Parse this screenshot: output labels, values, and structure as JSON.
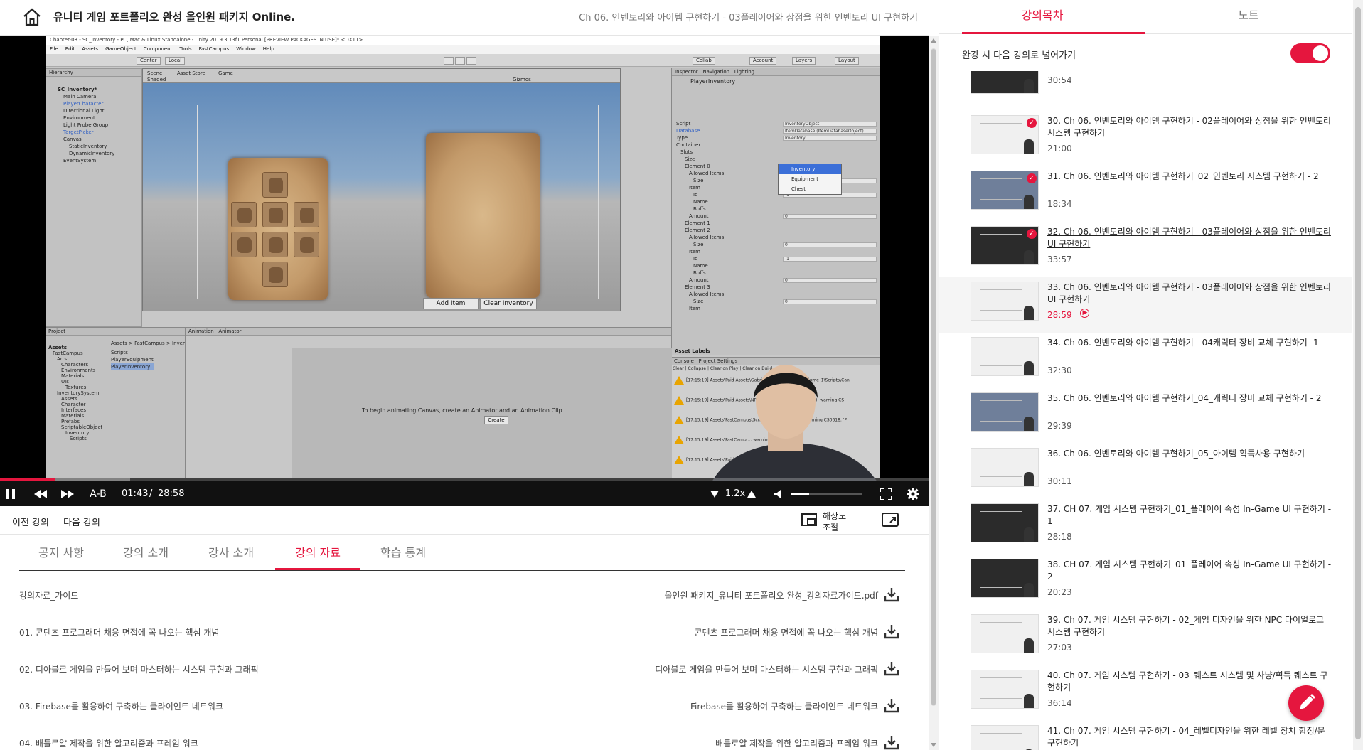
{
  "header": {
    "course_title": "유니티 게임 포트폴리오 완성 올인원 패키지 Online.",
    "lecture_title": "Ch 06. 인벤토리와 아이템 구현하기 - 03플레이어와 상점을 위한 인벤토리 UI 구현하기"
  },
  "unity": {
    "window_title": "Chapter-08 - SC_Inventory - PC, Mac & Linux Standalone - Unity 2019.3.13f1 Personal [PREVIEW PACKAGES IN USE]* <DX11>",
    "menu": [
      "File",
      "Edit",
      "Assets",
      "GameObject",
      "Component",
      "Tools",
      "FastCampus",
      "Window",
      "Help"
    ],
    "toolbar": {
      "center": "Center",
      "local": "Local",
      "collab": "Collab",
      "account": "Account",
      "layers": "Layers",
      "layout": "Layout"
    },
    "hierarchy_tab": "Hierarchy",
    "hierarchy": [
      "SC_Inventory*",
      "Main Camera",
      "PlayerCharacter",
      "Directional Light",
      "Environment",
      "Light Probe Group",
      "TargetPicker",
      "Canvas",
      "StaticInventory",
      "DynamicInventory",
      "EventSystem"
    ],
    "scene_tabs": [
      "Scene",
      "Asset Store",
      "Game"
    ],
    "scene_mode": "Shaded",
    "gizmos": "Gizmos",
    "buttons": {
      "add_item": "Add Item",
      "clear_inventory": "Clear Inventory"
    },
    "inspector_tabs": [
      "Inspector",
      "Navigation",
      "Lighting"
    ],
    "inspector_object": "PlayerInventory",
    "inspector_rows": [
      {
        "label": "Script",
        "value": "InventoryObject"
      },
      {
        "label": "Database",
        "value": "ItemDatabase (ItemDatabaseObject)"
      },
      {
        "label": "Type",
        "value": "Inventory"
      },
      {
        "label": "Container",
        "value": ""
      },
      {
        "label": "Slots",
        "value": ""
      },
      {
        "label": "Size",
        "value": ""
      },
      {
        "label": "Element 0",
        "value": ""
      },
      {
        "label": "Allowed Items",
        "value": ""
      },
      {
        "label": "Size",
        "value": "0"
      },
      {
        "label": "Item",
        "value": ""
      },
      {
        "label": "Id",
        "value": "-1"
      },
      {
        "label": "Name",
        "value": ""
      },
      {
        "label": "Buffs",
        "value": ""
      },
      {
        "label": "Amount",
        "value": "0"
      },
      {
        "label": "Element 1",
        "value": ""
      },
      {
        "label": "Element 2",
        "value": ""
      },
      {
        "label": "Allowed Items",
        "value": ""
      },
      {
        "label": "Size",
        "value": "0"
      },
      {
        "label": "Item",
        "value": ""
      },
      {
        "label": "Id",
        "value": "-1"
      },
      {
        "label": "Name",
        "value": ""
      },
      {
        "label": "Buffs",
        "value": ""
      },
      {
        "label": "Amount",
        "value": "0"
      },
      {
        "label": "Element 3",
        "value": ""
      },
      {
        "label": "Allowed Items",
        "value": ""
      },
      {
        "label": "Size",
        "value": "0"
      },
      {
        "label": "Item",
        "value": ""
      }
    ],
    "type_options": [
      "Inventory",
      "Equipment",
      "Chest"
    ],
    "asset_labels": "Asset Labels",
    "console_tabs": [
      "Console",
      "Project Settings"
    ],
    "console_buttons": [
      "Clear",
      "Collapse",
      "Clear on Play",
      "Clear on Build"
    ],
    "console_rows": [
      "[17:15:19] Assets\\Paid Assets\\GabrielAguiar\\...\\ectiles_Volume_1\\Scripts\\Can",
      "[17:15:19] Assets\\Paid Assets\\NPCHealth...\\arEditor.cs(90,13): warning CS",
      "[17:15:19] Assets\\FastCampus\\Scripts\\Edit...\\cs(26,25): warning CS0618: 'P",
      "[17:15:19] Assets\\FastCamp...: warning CS0618: 'Pr",
      "[17:15:19] Assets\\Paid Asset...: warning CS0618: 'P"
    ],
    "project_tab": "Project",
    "animation_tabs": [
      "Animation",
      "Animator"
    ],
    "project_tree": [
      "Assets",
      "FastCampus",
      "Arts",
      "Characters",
      "Environments",
      "Materials",
      "UIs",
      "Textures",
      "InventorySystem",
      "Assets",
      "Character",
      "Interfaces",
      "Materials",
      "Prefabs",
      "ScriptableObject",
      "Inventory",
      "Scripts"
    ],
    "project_path": "Assets > FastCampus > InventoryS",
    "project_files": [
      "Scripts",
      "PlayerEquipment",
      "PlayerInventory"
    ],
    "animation_hint": "To begin animating Canvas, create an Animator and an Animation Clip.",
    "animation_create": "Create"
  },
  "player": {
    "current_time": "01:43",
    "separator": "/",
    "total_time": "28:58",
    "ab_label": "A-B",
    "speed": "1.2x",
    "progress": 0.059,
    "volume": 0.25
  },
  "nav": {
    "prev": "이전 강의",
    "next": "다음 강의",
    "resolution": "해상도\n조절"
  },
  "tabs": [
    "공지 사항",
    "강의 소개",
    "강사 소개",
    "강의 자료",
    "학습 통계"
  ],
  "materials": [
    {
      "title": "강의자료_가이드",
      "file": "올인원 패키지_유니티 포트폴리오 완성_강의자료가이드.pdf"
    },
    {
      "title": "01. 콘텐츠 프로그래머 채용 면접에 꼭 나오는 핵심 개념",
      "file": "콘텐츠 프로그래머 채용 면접에 꼭 나오는 핵심 개념"
    },
    {
      "title": "02. 디아블로 게임을 만들어 보며 마스터하는 시스템 구현과 그래픽",
      "file": "디아블로 게임을 만들어 보며 마스터하는 시스템 구현과 그래픽"
    },
    {
      "title": "03. Firebase를 활용하여 구축하는 클라이언트 네트워크",
      "file": "Firebase를 활용하여 구축하는 클라이언트 네트워크"
    },
    {
      "title": "04. 배틀로얄 제작을 위한 알고리즘과 프레임 워크",
      "file": "배틀로얄 제작을 위한 알고리즘과 프레임 워크"
    }
  ],
  "sidebar": {
    "tabs": [
      "강의목차",
      "노트"
    ],
    "autoplay_label": "완강 시 다음 강의로 넘어가기",
    "autoplay_on": true,
    "lessons": [
      {
        "title": "",
        "duration": "30:54",
        "done": false,
        "thumb": "dark"
      },
      {
        "title": "30. Ch 06. 인벤토리와 아이템 구현하기 - 02플레이어와 상점을 위한 인벤토리 시스템 구현하기",
        "duration": "21:00",
        "done": true,
        "thumb": "light"
      },
      {
        "title": "31. Ch 06. 인벤토리와 아이템 구현하기_02_인벤토리 시스템 구현하기 - 2",
        "duration": "18:34",
        "done": true,
        "thumb": "video"
      },
      {
        "title": "32. Ch 06. 인벤토리와 아이템 구현하기 - 03플레이어와 상점을 위한 인벤토리 UI 구현하기",
        "duration": "33:57",
        "done": true,
        "thumb": "dark"
      },
      {
        "title": "33. Ch 06. 인벤토리와 아이템 구현하기 - 03플레이어와 상점을 위한 인벤토리 UI 구현하기",
        "duration": "28:59",
        "done": false,
        "thumb": "light"
      },
      {
        "title": "34. Ch 06. 인벤토리와 아이템 구현하기 - 04캐릭터 장비 교체 구현하기 -1",
        "duration": "32:30",
        "done": false,
        "thumb": "light"
      },
      {
        "title": "35. Ch 06. 인벤토리와 아이템 구현하기_04_캐릭터 장비 교체 구현하기 - 2",
        "duration": "29:39",
        "done": false,
        "thumb": "video"
      },
      {
        "title": "36. Ch 06. 인벤토리와 아이템 구현하기_05_아이템 획득사용 구현하기",
        "duration": "30:11",
        "done": false,
        "thumb": "light"
      },
      {
        "title": "37. CH 07. 게임 시스템 구현하기_01_플레이어 속성 In-Game UI 구현하기 - 1",
        "duration": "28:18",
        "done": false,
        "thumb": "dark"
      },
      {
        "title": "38. CH 07. 게임 시스템 구현하기_01_플레이어 속성 In-Game UI 구현하기 - 2",
        "duration": "20:23",
        "done": false,
        "thumb": "dark"
      },
      {
        "title": "39. Ch 07. 게임 시스템 구현하기 - 02_게임 디자인을 위한 NPC 다이얼로그 시스템 구현하기",
        "duration": "27:03",
        "done": false,
        "thumb": "light"
      },
      {
        "title": "40. Ch 07. 게임 시스템 구현하기 - 03_퀘스트 시스템 및 사냥/획득 퀘스트 구현하기",
        "duration": "36:14",
        "done": false,
        "thumb": "light"
      },
      {
        "title": "41. Ch 07. 게임 시스템 구현하기 - 04_레벨디자인을 위한 레벨 장치 함정/문 구현하기",
        "duration": "",
        "done": false,
        "thumb": "light"
      }
    ]
  },
  "colors": {
    "accent": "#e5163e"
  }
}
